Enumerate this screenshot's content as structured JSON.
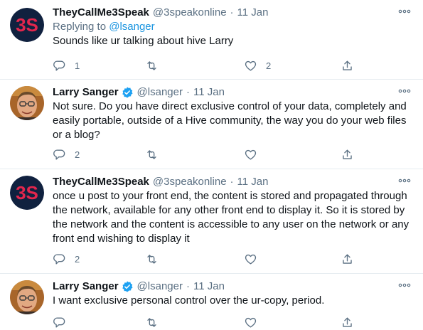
{
  "tweets": [
    {
      "name": "TheyCallMe3Speak",
      "verified": false,
      "handle": "@3speakonline",
      "sep": "·",
      "date": "11 Jan",
      "replying_prefix": "Replying to",
      "replying_handle": "@lsanger",
      "lines": [
        "Sounds like ur talking about hive Larry"
      ],
      "reply_count": "1",
      "retweet_count": "",
      "like_count": "2"
    },
    {
      "name": "Larry Sanger",
      "verified": true,
      "handle": "@lsanger",
      "sep": "·",
      "date": "11 Jan",
      "lines": [
        "Not sure. Do you have direct exclusive control of your data, completely and",
        "easily portable, outside of a Hive community, the way you do your web files",
        "or a blog?"
      ],
      "reply_count": "2",
      "retweet_count": "",
      "like_count": ""
    },
    {
      "name": "TheyCallMe3Speak",
      "verified": false,
      "handle": "@3speakonline",
      "sep": "·",
      "date": "11 Jan",
      "lines": [
        "once u post to your front end, the content is stored and propagated through",
        "the network, available for any other front end to display it. So it is stored by",
        "the network and the content is accessible to any user on the network or any",
        "front end wishing to display it"
      ],
      "reply_count": "2",
      "retweet_count": "",
      "like_count": ""
    },
    {
      "name": "Larry Sanger",
      "verified": true,
      "handle": "@lsanger",
      "sep": "·",
      "date": "11 Jan",
      "lines": [
        "I want exclusive personal control over the ur-copy, period."
      ],
      "reply_count": "",
      "retweet_count": "",
      "like_count": ""
    }
  ],
  "icons": {
    "avatar_3speak": "3speak-logo-avatar",
    "avatar_larry": "larry-sanger-avatar",
    "verified": "verified-badge-icon",
    "more": "more-options-icon",
    "reply": "reply-icon",
    "retweet": "retweet-icon",
    "like": "like-icon",
    "share": "share-icon"
  },
  "colors": {
    "link": "#1b95e0",
    "muted": "#5b7083",
    "verified": "#1da1f2",
    "divider": "#e6ecf0"
  }
}
